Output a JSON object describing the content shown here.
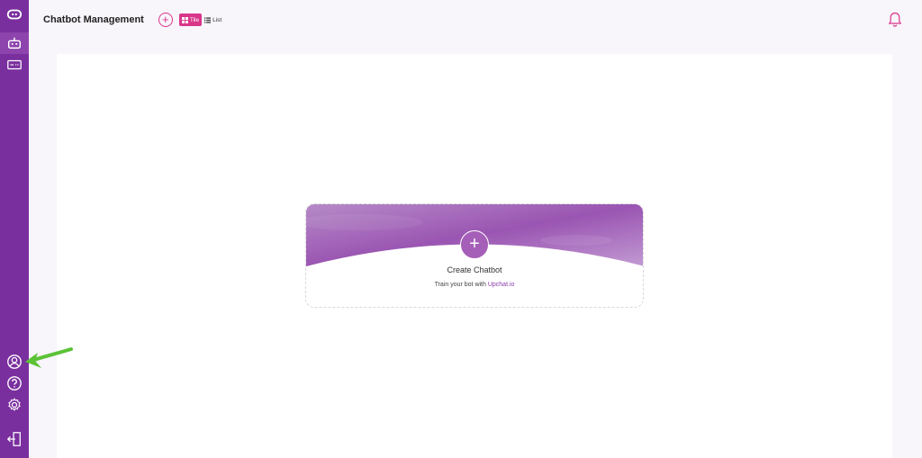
{
  "sidebar": {
    "top_items": [
      {
        "icon": "chatbot-logo-icon"
      },
      {
        "icon": "robot-icon"
      },
      {
        "icon": "ticket-icon"
      }
    ],
    "bottom_items": [
      {
        "icon": "user-icon"
      },
      {
        "icon": "help-icon"
      },
      {
        "icon": "settings-icon"
      },
      {
        "icon": "logout-icon"
      }
    ],
    "color": "#7a2f9e"
  },
  "header": {
    "title": "Chatbot Management",
    "add_label": "+",
    "view_tile_label": "Tile",
    "view_list_label": "List",
    "active_view": "Tile",
    "accent": "#d9368a"
  },
  "card": {
    "plus_label": "+",
    "title": "Create Chatbot",
    "subtitle_prefix": "Train your bot with ",
    "subtitle_link": "Upchat.io"
  },
  "annotation": {
    "icon": "green-arrow-icon",
    "color": "#5bc236"
  }
}
